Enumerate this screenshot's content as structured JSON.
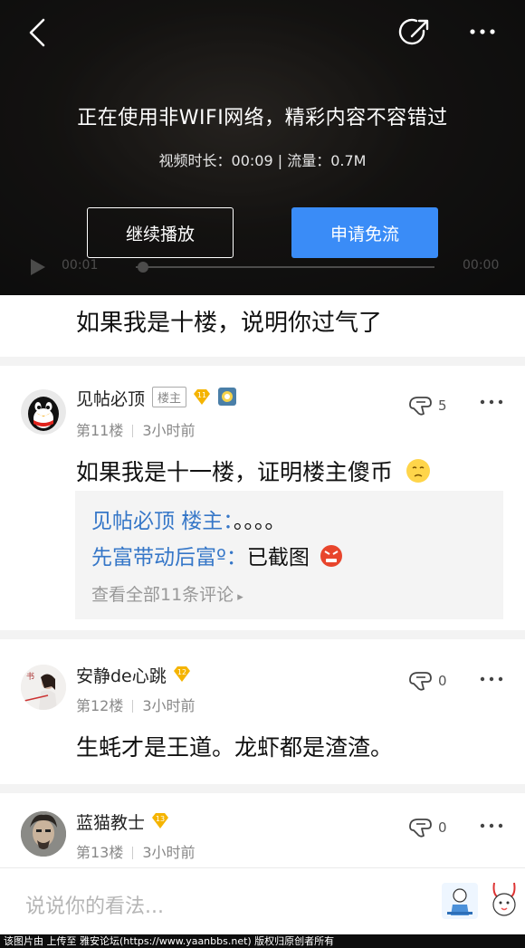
{
  "video": {
    "notice": "正在使用非WIFI网络，精彩内容不容错过",
    "meta": "视频时长：00:09  |  流量：0.7M",
    "continue_label": "继续播放",
    "free_label": "申请免流",
    "time_current": "00:01",
    "time_total": "00:00"
  },
  "prev_content": "如果我是十楼，说明你过气了",
  "posts": [
    {
      "username": "见帖必顶",
      "host_badge": "楼主",
      "level": "11",
      "floor": "第11楼",
      "time": "3小时前",
      "likes": "5",
      "content": "如果我是十一楼，证明楼主傻币",
      "replies": [
        {
          "who": "见帖必顶 楼主：",
          "text": "。。。。"
        },
        {
          "who": "先富带动后富º：",
          "text": "已截图"
        }
      ],
      "more_replies": "查看全部11条评论"
    },
    {
      "username": "安静de心跳",
      "level": "12",
      "floor": "第12楼",
      "time": "3小时前",
      "likes": "0",
      "content": "生蚝才是王道。龙虾都是渣渣。"
    },
    {
      "username": "蓝猫教士",
      "level": "13",
      "floor": "第13楼",
      "time": "3小时前",
      "likes": "0"
    }
  ],
  "input": {
    "placeholder": "说说你的看法..."
  },
  "footer": "该图片由  上传至  雅安论坛(https://www.yaanbbs.net) 版权归原创者所有",
  "colors": {
    "accent": "#3a8cf7",
    "reply_name": "#3677c8",
    "level_badge": "#f5b400"
  }
}
